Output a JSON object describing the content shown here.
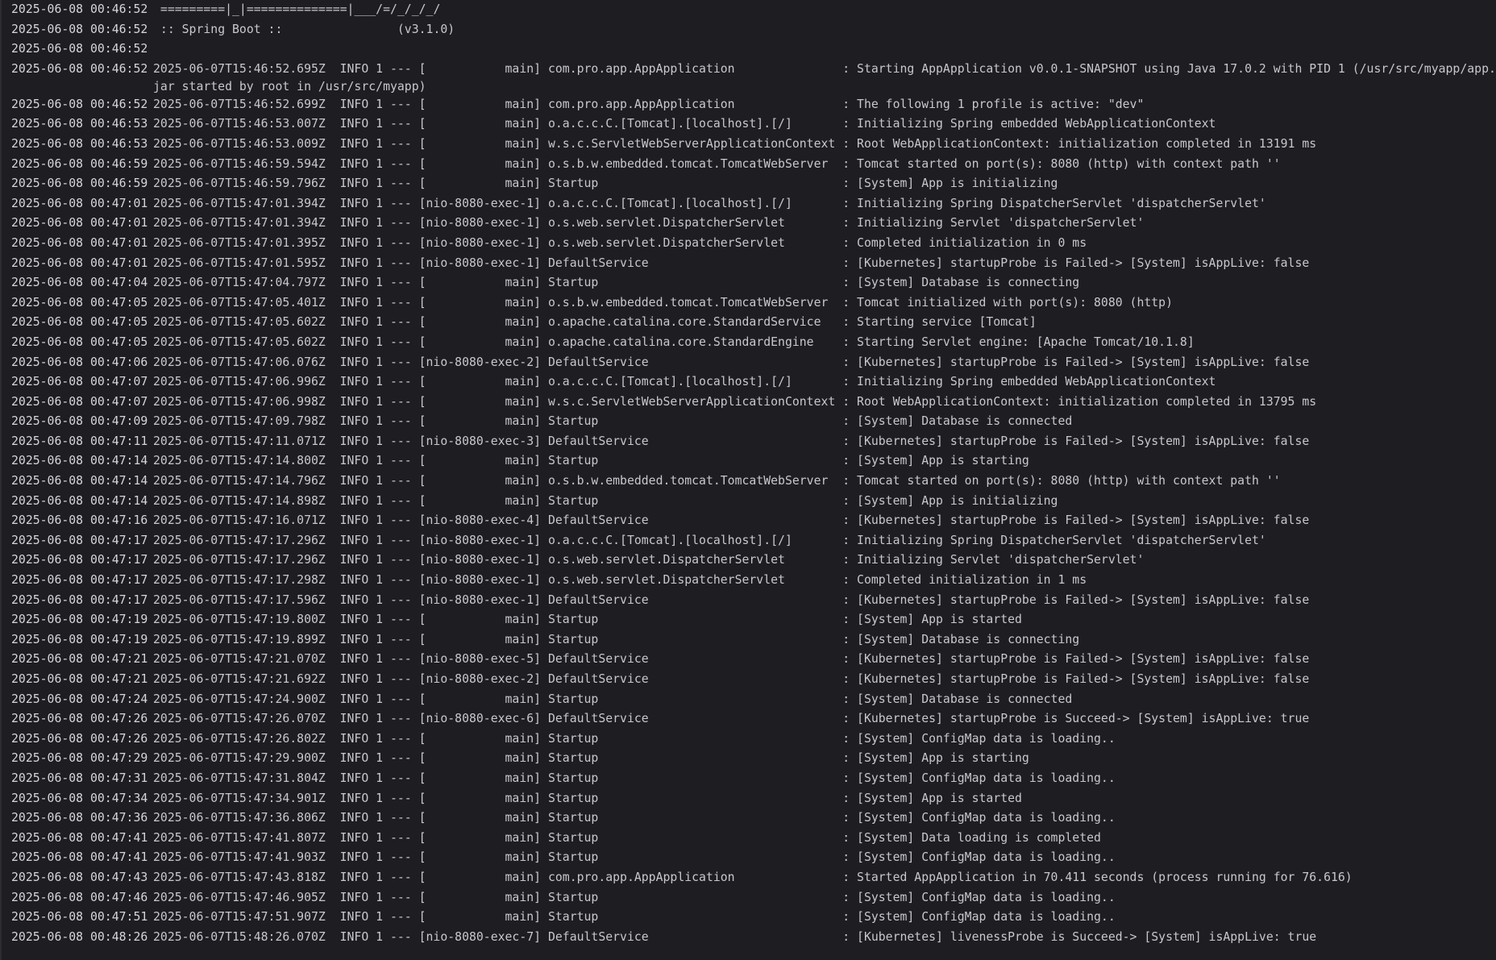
{
  "log_lines": [
    {
      "ts": "2025-06-08 00:46:52",
      "msg": " =========|_|==============|___/=/_/_/_/"
    },
    {
      "ts": "2025-06-08 00:46:52",
      "msg": " :: Spring Boot ::                (v3.1.0)"
    },
    {
      "ts": "2025-06-08 00:46:52",
      "msg": ""
    },
    {
      "ts": "2025-06-08 00:46:52",
      "msg": "2025-06-07T15:46:52.695Z  INFO 1 --- [           main] com.pro.app.AppApplication               : Starting AppApplication v0.0.1-SNAPSHOT using Java 17.0.2 with PID 1 (/usr/src/myapp/app.jar started by root in /usr/src/myapp)"
    },
    {
      "ts": "2025-06-08 00:46:52",
      "msg": "2025-06-07T15:46:52.699Z  INFO 1 --- [           main] com.pro.app.AppApplication               : The following 1 profile is active: \"dev\""
    },
    {
      "ts": "2025-06-08 00:46:53",
      "msg": "2025-06-07T15:46:53.007Z  INFO 1 --- [           main] o.a.c.c.C.[Tomcat].[localhost].[/]       : Initializing Spring embedded WebApplicationContext"
    },
    {
      "ts": "2025-06-08 00:46:53",
      "msg": "2025-06-07T15:46:53.009Z  INFO 1 --- [           main] w.s.c.ServletWebServerApplicationContext : Root WebApplicationContext: initialization completed in 13191 ms"
    },
    {
      "ts": "2025-06-08 00:46:59",
      "msg": "2025-06-07T15:46:59.594Z  INFO 1 --- [           main] o.s.b.w.embedded.tomcat.TomcatWebServer  : Tomcat started on port(s): 8080 (http) with context path ''"
    },
    {
      "ts": "2025-06-08 00:46:59",
      "msg": "2025-06-07T15:46:59.796Z  INFO 1 --- [           main] Startup                                  : [System] App is initializing"
    },
    {
      "ts": "2025-06-08 00:47:01",
      "msg": "2025-06-07T15:47:01.394Z  INFO 1 --- [nio-8080-exec-1] o.a.c.c.C.[Tomcat].[localhost].[/]       : Initializing Spring DispatcherServlet 'dispatcherServlet'"
    },
    {
      "ts": "2025-06-08 00:47:01",
      "msg": "2025-06-07T15:47:01.394Z  INFO 1 --- [nio-8080-exec-1] o.s.web.servlet.DispatcherServlet        : Initializing Servlet 'dispatcherServlet'"
    },
    {
      "ts": "2025-06-08 00:47:01",
      "msg": "2025-06-07T15:47:01.395Z  INFO 1 --- [nio-8080-exec-1] o.s.web.servlet.DispatcherServlet        : Completed initialization in 0 ms"
    },
    {
      "ts": "2025-06-08 00:47:01",
      "msg": "2025-06-07T15:47:01.595Z  INFO 1 --- [nio-8080-exec-1] DefaultService                           : [Kubernetes] startupProbe is Failed-> [System] isAppLive: false"
    },
    {
      "ts": "2025-06-08 00:47:04",
      "msg": "2025-06-07T15:47:04.797Z  INFO 1 --- [           main] Startup                                  : [System] Database is connecting"
    },
    {
      "ts": "2025-06-08 00:47:05",
      "msg": "2025-06-07T15:47:05.401Z  INFO 1 --- [           main] o.s.b.w.embedded.tomcat.TomcatWebServer  : Tomcat initialized with port(s): 8080 (http)"
    },
    {
      "ts": "2025-06-08 00:47:05",
      "msg": "2025-06-07T15:47:05.602Z  INFO 1 --- [           main] o.apache.catalina.core.StandardService   : Starting service [Tomcat]"
    },
    {
      "ts": "2025-06-08 00:47:05",
      "msg": "2025-06-07T15:47:05.602Z  INFO 1 --- [           main] o.apache.catalina.core.StandardEngine    : Starting Servlet engine: [Apache Tomcat/10.1.8]"
    },
    {
      "ts": "2025-06-08 00:47:06",
      "msg": "2025-06-07T15:47:06.076Z  INFO 1 --- [nio-8080-exec-2] DefaultService                           : [Kubernetes] startupProbe is Failed-> [System] isAppLive: false"
    },
    {
      "ts": "2025-06-08 00:47:07",
      "msg": "2025-06-07T15:47:06.996Z  INFO 1 --- [           main] o.a.c.c.C.[Tomcat].[localhost].[/]       : Initializing Spring embedded WebApplicationContext"
    },
    {
      "ts": "2025-06-08 00:47:07",
      "msg": "2025-06-07T15:47:06.998Z  INFO 1 --- [           main] w.s.c.ServletWebServerApplicationContext : Root WebApplicationContext: initialization completed in 13795 ms"
    },
    {
      "ts": "2025-06-08 00:47:09",
      "msg": "2025-06-07T15:47:09.798Z  INFO 1 --- [           main] Startup                                  : [System] Database is connected"
    },
    {
      "ts": "2025-06-08 00:47:11",
      "msg": "2025-06-07T15:47:11.071Z  INFO 1 --- [nio-8080-exec-3] DefaultService                           : [Kubernetes] startupProbe is Failed-> [System] isAppLive: false"
    },
    {
      "ts": "2025-06-08 00:47:14",
      "msg": "2025-06-07T15:47:14.800Z  INFO 1 --- [           main] Startup                                  : [System] App is starting"
    },
    {
      "ts": "2025-06-08 00:47:14",
      "msg": "2025-06-07T15:47:14.796Z  INFO 1 --- [           main] o.s.b.w.embedded.tomcat.TomcatWebServer  : Tomcat started on port(s): 8080 (http) with context path ''"
    },
    {
      "ts": "2025-06-08 00:47:14",
      "msg": "2025-06-07T15:47:14.898Z  INFO 1 --- [           main] Startup                                  : [System] App is initializing"
    },
    {
      "ts": "2025-06-08 00:47:16",
      "msg": "2025-06-07T15:47:16.071Z  INFO 1 --- [nio-8080-exec-4] DefaultService                           : [Kubernetes] startupProbe is Failed-> [System] isAppLive: false"
    },
    {
      "ts": "2025-06-08 00:47:17",
      "msg": "2025-06-07T15:47:17.296Z  INFO 1 --- [nio-8080-exec-1] o.a.c.c.C.[Tomcat].[localhost].[/]       : Initializing Spring DispatcherServlet 'dispatcherServlet'"
    },
    {
      "ts": "2025-06-08 00:47:17",
      "msg": "2025-06-07T15:47:17.296Z  INFO 1 --- [nio-8080-exec-1] o.s.web.servlet.DispatcherServlet        : Initializing Servlet 'dispatcherServlet'"
    },
    {
      "ts": "2025-06-08 00:47:17",
      "msg": "2025-06-07T15:47:17.298Z  INFO 1 --- [nio-8080-exec-1] o.s.web.servlet.DispatcherServlet        : Completed initialization in 1 ms"
    },
    {
      "ts": "2025-06-08 00:47:17",
      "msg": "2025-06-07T15:47:17.596Z  INFO 1 --- [nio-8080-exec-1] DefaultService                           : [Kubernetes] startupProbe is Failed-> [System] isAppLive: false"
    },
    {
      "ts": "2025-06-08 00:47:19",
      "msg": "2025-06-07T15:47:19.800Z  INFO 1 --- [           main] Startup                                  : [System] App is started"
    },
    {
      "ts": "2025-06-08 00:47:19",
      "msg": "2025-06-07T15:47:19.899Z  INFO 1 --- [           main] Startup                                  : [System] Database is connecting"
    },
    {
      "ts": "2025-06-08 00:47:21",
      "msg": "2025-06-07T15:47:21.070Z  INFO 1 --- [nio-8080-exec-5] DefaultService                           : [Kubernetes] startupProbe is Failed-> [System] isAppLive: false"
    },
    {
      "ts": "2025-06-08 00:47:21",
      "msg": "2025-06-07T15:47:21.692Z  INFO 1 --- [nio-8080-exec-2] DefaultService                           : [Kubernetes] startupProbe is Failed-> [System] isAppLive: false"
    },
    {
      "ts": "2025-06-08 00:47:24",
      "msg": "2025-06-07T15:47:24.900Z  INFO 1 --- [           main] Startup                                  : [System] Database is connected"
    },
    {
      "ts": "2025-06-08 00:47:26",
      "msg": "2025-06-07T15:47:26.070Z  INFO 1 --- [nio-8080-exec-6] DefaultService                           : [Kubernetes] startupProbe is Succeed-> [System] isAppLive: true"
    },
    {
      "ts": "2025-06-08 00:47:26",
      "msg": "2025-06-07T15:47:26.802Z  INFO 1 --- [           main] Startup                                  : [System] ConfigMap data is loading.."
    },
    {
      "ts": "2025-06-08 00:47:29",
      "msg": "2025-06-07T15:47:29.900Z  INFO 1 --- [           main] Startup                                  : [System] App is starting"
    },
    {
      "ts": "2025-06-08 00:47:31",
      "msg": "2025-06-07T15:47:31.804Z  INFO 1 --- [           main] Startup                                  : [System] ConfigMap data is loading.."
    },
    {
      "ts": "2025-06-08 00:47:34",
      "msg": "2025-06-07T15:47:34.901Z  INFO 1 --- [           main] Startup                                  : [System] App is started"
    },
    {
      "ts": "2025-06-08 00:47:36",
      "msg": "2025-06-07T15:47:36.806Z  INFO 1 --- [           main] Startup                                  : [System] ConfigMap data is loading.."
    },
    {
      "ts": "2025-06-08 00:47:41",
      "msg": "2025-06-07T15:47:41.807Z  INFO 1 --- [           main] Startup                                  : [System] Data loading is completed"
    },
    {
      "ts": "2025-06-08 00:47:41",
      "msg": "2025-06-07T15:47:41.903Z  INFO 1 --- [           main] Startup                                  : [System] ConfigMap data is loading.."
    },
    {
      "ts": "2025-06-08 00:47:43",
      "msg": "2025-06-07T15:47:43.818Z  INFO 1 --- [           main] com.pro.app.AppApplication               : Started AppApplication in 70.411 seconds (process running for 76.616)"
    },
    {
      "ts": "2025-06-08 00:47:46",
      "msg": "2025-06-07T15:47:46.905Z  INFO 1 --- [           main] Startup                                  : [System] ConfigMap data is loading.."
    },
    {
      "ts": "2025-06-08 00:47:51",
      "msg": "2025-06-07T15:47:51.907Z  INFO 1 --- [           main] Startup                                  : [System] ConfigMap data is loading.."
    },
    {
      "ts": "2025-06-08 00:48:26",
      "msg": "2025-06-07T15:48:26.070Z  INFO 1 --- [nio-8080-exec-7] DefaultService                           : [Kubernetes] livenessProbe is Succeed-> [System] isAppLive: true"
    }
  ]
}
